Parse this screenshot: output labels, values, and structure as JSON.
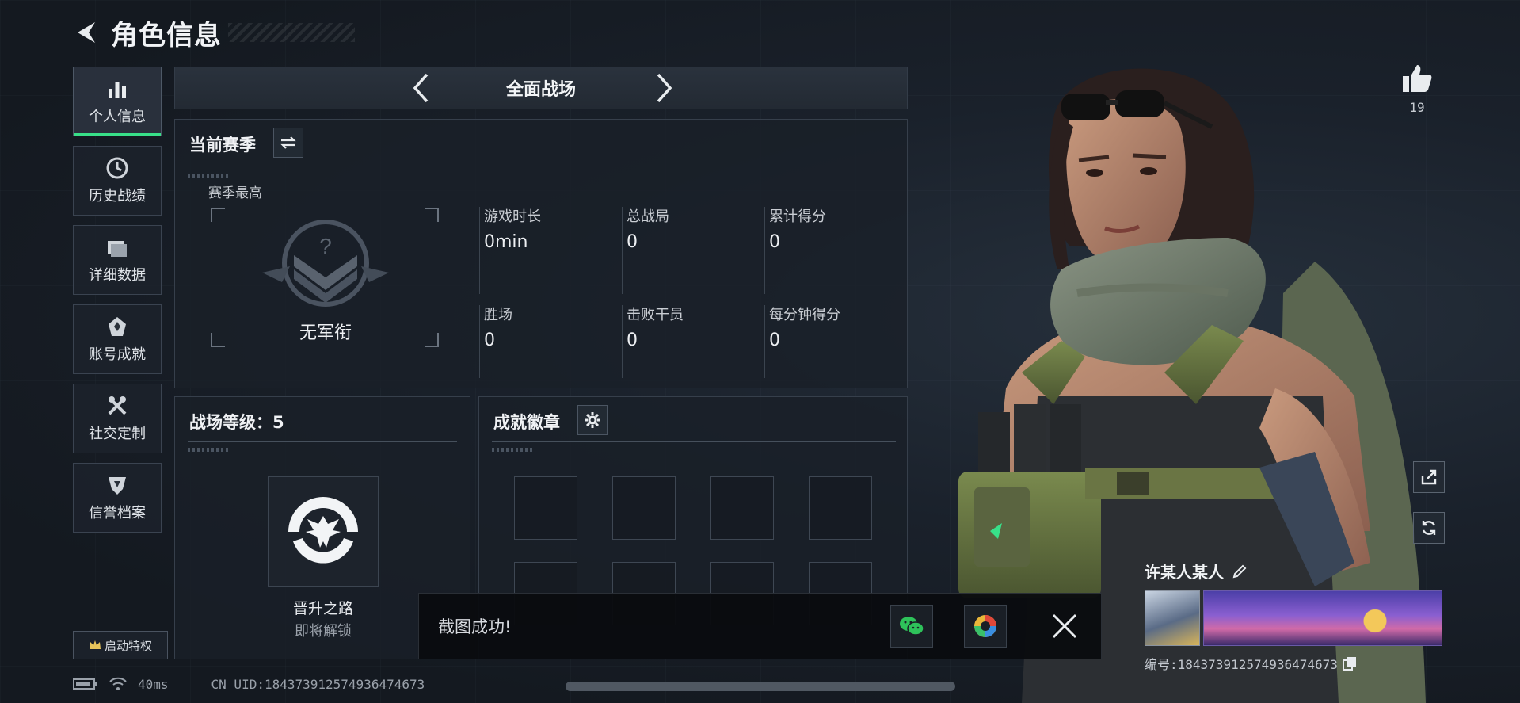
{
  "header": {
    "title": "角色信息"
  },
  "sidebar": {
    "items": [
      {
        "label": "个人信息",
        "icon": "bar-chart-icon",
        "active": true
      },
      {
        "label": "历史战绩",
        "icon": "history-clock-icon"
      },
      {
        "label": "详细数据",
        "icon": "folder-icon"
      },
      {
        "label": "账号成就",
        "icon": "achievement-icon"
      },
      {
        "label": "社交定制",
        "icon": "tools-icon"
      },
      {
        "label": "信誉档案",
        "icon": "shield-icon"
      }
    ],
    "vip_label": "启动特权"
  },
  "mode": {
    "title": "全面战场"
  },
  "season": {
    "title": "当前赛季",
    "sub": "赛季最高",
    "rank_name": "无军衔",
    "stats": [
      {
        "label": "游戏时长",
        "value": "0min"
      },
      {
        "label": "总战局",
        "value": "0"
      },
      {
        "label": "累计得分",
        "value": "0"
      },
      {
        "label": "胜场",
        "value": "0"
      },
      {
        "label": "击败干员",
        "value": "0"
      },
      {
        "label": "每分钟得分",
        "value": "0"
      }
    ]
  },
  "level": {
    "title": "战场等级：5",
    "caption": "晋升之路",
    "status": "即将解锁"
  },
  "achievements": {
    "title": "成就徽章"
  },
  "toast": {
    "text": "截图成功!"
  },
  "status_bar": {
    "ping": "40ms",
    "uid": "CN UID:1843739125749364746​73"
  },
  "profile": {
    "like_count": "19",
    "player_name": "许某人某人",
    "player_uid": "编号:1843739125749364746​73"
  },
  "colors": {
    "accent": "#38e089",
    "panel_bg": "#1a2028",
    "border": "#363f4b"
  }
}
